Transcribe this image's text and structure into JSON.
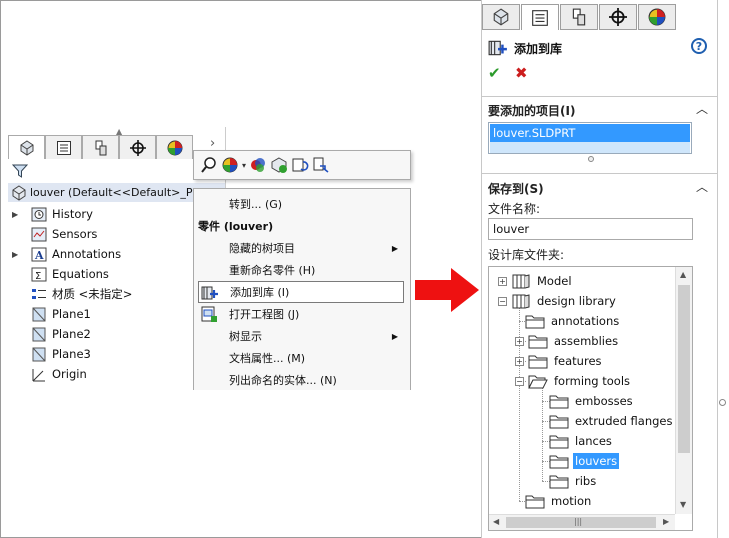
{
  "feature_tree": {
    "root_label": "louver  (Default<<Default>_Pho",
    "items": [
      {
        "label": "History",
        "expandable": true,
        "icon": "history-icon"
      },
      {
        "label": "Sensors",
        "expandable": false,
        "icon": "sensors-icon"
      },
      {
        "label": "Annotations",
        "expandable": true,
        "icon": "annotations-icon"
      },
      {
        "label": "Equations",
        "expandable": false,
        "icon": "equations-icon"
      },
      {
        "label": "材质 <未指定>",
        "expandable": false,
        "icon": "material-icon"
      },
      {
        "label": "Plane1",
        "expandable": false,
        "icon": "plane-icon"
      },
      {
        "label": "Plane2",
        "expandable": false,
        "icon": "plane-icon"
      },
      {
        "label": "Plane3",
        "expandable": false,
        "icon": "plane-icon"
      },
      {
        "label": "Origin",
        "expandable": false,
        "icon": "origin-icon"
      }
    ]
  },
  "context_menu": {
    "items": [
      {
        "label": "转到... (G)",
        "type": "item"
      },
      {
        "label": "零件 (louver)",
        "type": "header"
      },
      {
        "label": "隐藏的树项目",
        "type": "submenu"
      },
      {
        "label": "重新命名零件 (H)",
        "type": "item"
      },
      {
        "label": "添加到库 (I)",
        "type": "item",
        "highlighted": true
      },
      {
        "label": "打开工程图 (J)",
        "type": "item"
      },
      {
        "label": "树显示",
        "type": "submenu"
      },
      {
        "label": "文档属性... (M)",
        "type": "item"
      },
      {
        "label": "列出命名的实体... (N)",
        "type": "item"
      }
    ]
  },
  "property_manager": {
    "title": "添加到库",
    "items_section": {
      "title": "要添加的项目(I)",
      "selected_item": "louver.SLDPRT"
    },
    "save_section": {
      "title": "保存到(S)",
      "file_name_label": "文件名称:",
      "file_name": "louver",
      "folder_label": "设计库文件夹:",
      "tree": [
        {
          "label": "Model",
          "level": 0,
          "box": "+",
          "icon": "library-icon"
        },
        {
          "label": "design library",
          "level": 0,
          "box": "-",
          "icon": "library-icon"
        },
        {
          "label": "annotations",
          "level": 1,
          "box": "",
          "icon": "folder-icon"
        },
        {
          "label": "assemblies",
          "level": 1,
          "box": "+",
          "icon": "folder-icon"
        },
        {
          "label": "features",
          "level": 1,
          "box": "+",
          "icon": "folder-icon"
        },
        {
          "label": "forming tools",
          "level": 1,
          "box": "-",
          "icon": "folder-icon"
        },
        {
          "label": "embosses",
          "level": 2,
          "box": "",
          "icon": "folder-icon"
        },
        {
          "label": "extruded flanges",
          "level": 2,
          "box": "",
          "icon": "folder-icon"
        },
        {
          "label": "lances",
          "level": 2,
          "box": "",
          "icon": "folder-icon"
        },
        {
          "label": "louvers",
          "level": 2,
          "box": "",
          "icon": "folder-icon",
          "selected": true
        },
        {
          "label": "ribs",
          "level": 2,
          "box": "",
          "icon": "folder-icon"
        },
        {
          "label": "motion",
          "level": 1,
          "box": "",
          "icon": "folder-icon"
        }
      ]
    }
  },
  "colors": {
    "selection": "#3399ff",
    "arrow": "#ee1111",
    "ok": "#2c9b2c",
    "cancel": "#cc1e1e"
  }
}
